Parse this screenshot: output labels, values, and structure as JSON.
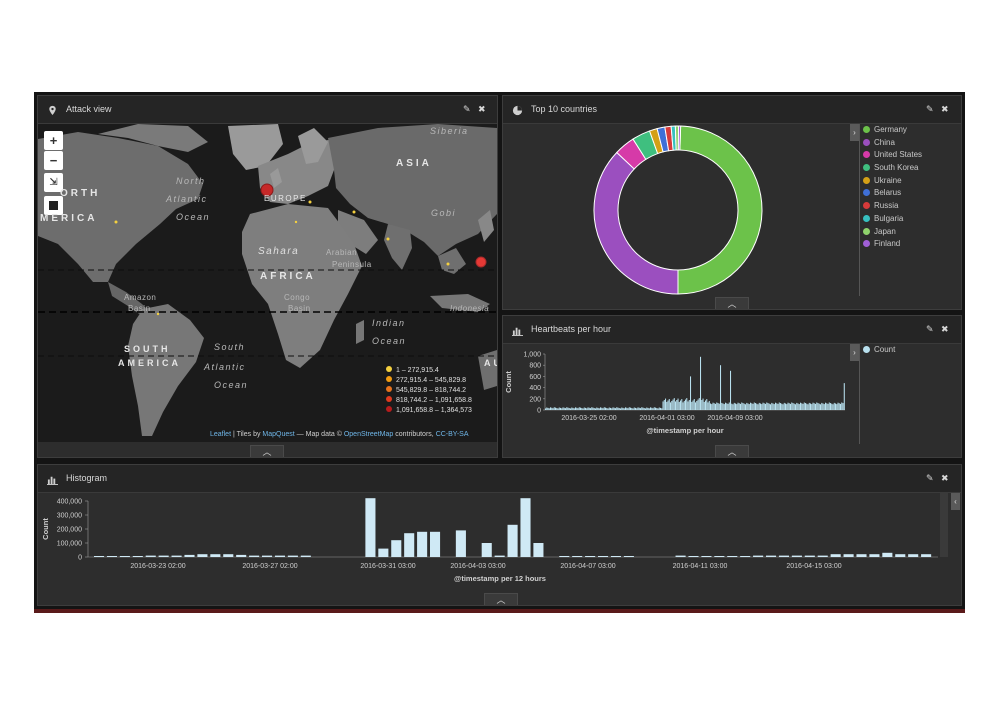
{
  "panels": {
    "attack_view": {
      "title": "Attack view",
      "zoom_in": "+",
      "zoom_out": "−",
      "labels": {
        "siberia": "Siberia",
        "asia": "ASIA",
        "north": "North",
        "atlantic": "Atlantic",
        "ocean": "Ocean",
        "europe": "EUROPE",
        "orth": "ORTH",
        "merica": "MERICA",
        "gobi": "Gobi",
        "sahara": "Sahara",
        "arabian": "Arabian",
        "peninsula": "Peninsula",
        "africa": "AFRICA",
        "indonesia": "Indonesia",
        "amazon": "Amazon",
        "basin": "Basin",
        "congo": "Congo",
        "congo_basin": "Basin",
        "indian": "Indian",
        "indian_ocean": "Ocean",
        "south": "South",
        "south_america_1": "SOUTH",
        "south_america_2": "AMERICA",
        "south_atlantic": "Atlantic",
        "south_ocean": "Ocean",
        "au": "AU"
      },
      "legend": [
        {
          "label": "1 – 272,915.4",
          "color": "#f4d03f"
        },
        {
          "label": "272,915.4 – 545,829.8",
          "color": "#f39c12"
        },
        {
          "label": "545,829.8 – 818,744.2",
          "color": "#e8731d"
        },
        {
          "label": "818,744.2 – 1,091,658.8",
          "color": "#e03a1e"
        },
        {
          "label": "1,091,658.8 – 1,364,573",
          "color": "#b71c1c"
        }
      ],
      "attribution": {
        "leaflet": "Leaflet",
        "tiles_by": " | Tiles by ",
        "mapquest": "MapQuest",
        "map_data": " — Map data © ",
        "osm": "OpenStreetMap",
        "contributors": " contributors, ",
        "license": "CC-BY-SA"
      }
    },
    "top_countries": {
      "title": "Top 10 countries",
      "chart_data": {
        "type": "pie",
        "donut": true,
        "categories": [
          "Germany",
          "China",
          "United States",
          "South Korea",
          "Ukraine",
          "Belarus",
          "Russia",
          "Bulgaria",
          "Japan",
          "Finland"
        ],
        "values": [
          49.5,
          37.0,
          4.0,
          3.5,
          1.5,
          1.5,
          1.2,
          0.8,
          0.6,
          0.4
        ],
        "colors": [
          "#6cc24a",
          "#9b4fbf",
          "#d63aa8",
          "#3fbf7f",
          "#d4a017",
          "#3f6fd6",
          "#d63a3a",
          "#37c0c0",
          "#8fd36c",
          "#a05fd6"
        ],
        "legend_position": "right"
      }
    },
    "heartbeats": {
      "title": "Heartbeats per hour",
      "legend": "Count",
      "chart_data": {
        "type": "bar",
        "xlabel": "@timestamp per hour",
        "ylabel": "Count",
        "ylim": [
          0,
          1000
        ],
        "yticks": [
          "0",
          "200",
          "400",
          "600",
          "800",
          "1,000"
        ],
        "xticks": [
          "2016-03-25 02:00",
          "2016-04-01 03:00",
          "2016-04-09 03:00"
        ],
        "x": [
          "2016-03-22 00:00",
          "2016-04-15 00:00"
        ],
        "values_profile": [
          {
            "segment": "2016-03-22 to 2016-03-31",
            "typical": 40
          },
          {
            "segment": "2016-03-31 to 2016-04-04",
            "typical": 170,
            "peaks": [
              950,
              800,
              700,
              600
            ]
          },
          {
            "segment": "2016-04-04 to 2016-04-15",
            "typical": 120
          }
        ],
        "color": "#b8e0ee"
      }
    },
    "histogram": {
      "title": "Histogram",
      "chart_data": {
        "type": "bar",
        "xlabel": "@timestamp per 12 hours",
        "ylabel": "Count",
        "ylim": [
          0,
          400000
        ],
        "yticks": [
          "0",
          "100,000",
          "200,000",
          "300,000",
          "400,000"
        ],
        "xticks": [
          "2016-03-23 02:00",
          "2016-03-27 02:00",
          "2016-03-31 03:00",
          "2016-04-03 03:00",
          "2016-04-07 03:00",
          "2016-04-11 03:00",
          "2016-04-15 03:00"
        ],
        "values": [
          5000,
          5000,
          5000,
          5000,
          10000,
          10000,
          10000,
          15000,
          20000,
          20000,
          20000,
          15000,
          10000,
          10000,
          10000,
          10000,
          10000,
          0,
          0,
          0,
          0,
          420000,
          60000,
          120000,
          170000,
          180000,
          180000,
          0,
          190000,
          0,
          100000,
          10000,
          230000,
          420000,
          100000,
          0,
          5000,
          5000,
          5000,
          5000,
          5000,
          5000,
          0,
          0,
          0,
          10000,
          5000,
          5000,
          5000,
          5000,
          5000,
          10000,
          10000,
          10000,
          10000,
          10000,
          10000,
          20000,
          20000,
          20000,
          20000,
          30000,
          20000,
          20000,
          20000
        ],
        "color": "#cfe9f5"
      }
    }
  },
  "icons": {
    "marker": "map-marker-icon",
    "pie": "pie-chart-icon",
    "bar": "bar-chart-icon",
    "edit": "pencil-icon",
    "close": "close-icon"
  }
}
